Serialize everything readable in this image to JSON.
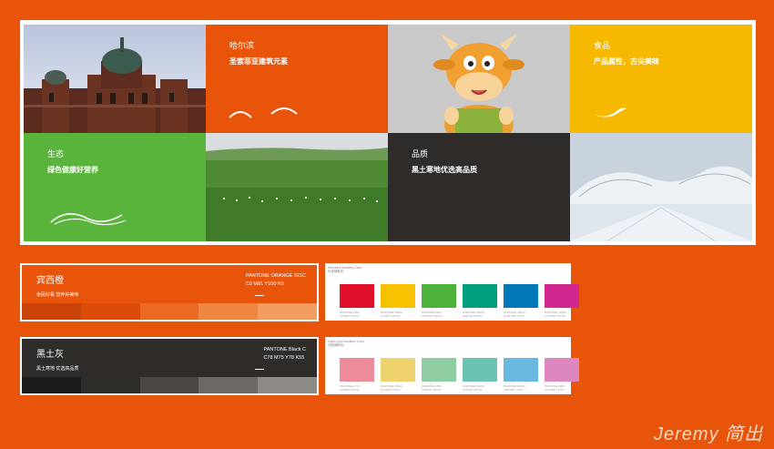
{
  "tiles": {
    "harbin": {
      "title": "哈尔滨",
      "subtitle": "圣索菲亚建筑元素"
    },
    "food": {
      "title": "食品",
      "subtitle": "产品属性，古尖美味"
    },
    "ecology": {
      "title": "生态",
      "subtitle": "绿色健康好营养"
    },
    "quality": {
      "title": "品质",
      "subtitle": "黑土寒地优选高品质"
    }
  },
  "swatches": [
    {
      "name": "宾西橙",
      "desc": "亲民好看 营养好美味",
      "pantone": "PANTONE ORANGE 021C",
      "cmyk": "C0  M81  Y100  K0",
      "bar": [
        "#c94309",
        "#dc4c08",
        "#ea6a23",
        "#ef8642",
        "#f19e60"
      ]
    },
    {
      "name": "黑土灰",
      "desc": "黑土寒地 优选高品质",
      "pantone": "PANTONE Black C",
      "cmyk": "C78  M75  Y78  K55",
      "bar": [
        "#1e1c1a",
        "#2e2c29",
        "#4a4744",
        "#6b6865",
        "#8e8b87"
      ]
    }
  ],
  "aux": [
    {
      "title": "Standard Auxiliary Color",
      "subtitle": "标准辅助色",
      "chips": [
        {
          "color": "#e0102b",
          "label": "PANTONE 185C",
          "cmyk": "C0 M93 Y79 K0"
        },
        {
          "color": "#f7c300",
          "label": "PANTONE 7408C",
          "cmyk": "C0 M24 Y95 K0"
        },
        {
          "color": "#4db23a",
          "label": "PANTONE 361C",
          "cmyk": "C69 M0 Y100 K0"
        },
        {
          "color": "#009f7d",
          "label": "PANTONE 3405C",
          "cmyk": "C85 M0 Y65 K0"
        },
        {
          "color": "#0077b6",
          "label": "PANTONE 7461C",
          "cmyk": "C100 M45 Y5 K0"
        },
        {
          "color": "#d1288f",
          "label": "PANTONE 7433C",
          "cmyk": "C15 M93 Y10 K0"
        }
      ]
    },
    {
      "title": "Light Color Auxiliary Color",
      "subtitle": "浅色辅助色",
      "chips": [
        {
          "color": "#ee8b99",
          "label": "PANTONE 177C",
          "cmyk": "C0 M55 Y25 K0"
        },
        {
          "color": "#eed26d",
          "label": "PANTONE 7403C",
          "cmyk": "C5 M15 Y65 K0"
        },
        {
          "color": "#8ecda1",
          "label": "PANTONE 353C",
          "cmyk": "C45 M0 Y45 K0"
        },
        {
          "color": "#6dc3b3",
          "label": "PANTONE 3248C",
          "cmyk": "C55 M0 Y35 K0"
        },
        {
          "color": "#6ab8e0",
          "label": "PANTONE 2915C",
          "cmyk": "C55 M10 Y5 K0"
        },
        {
          "color": "#de86c0",
          "label": "PANTONE 238C",
          "cmyk": "C15 M55 Y0 K0"
        }
      ]
    }
  ],
  "watermark": "Jeremy 简出"
}
